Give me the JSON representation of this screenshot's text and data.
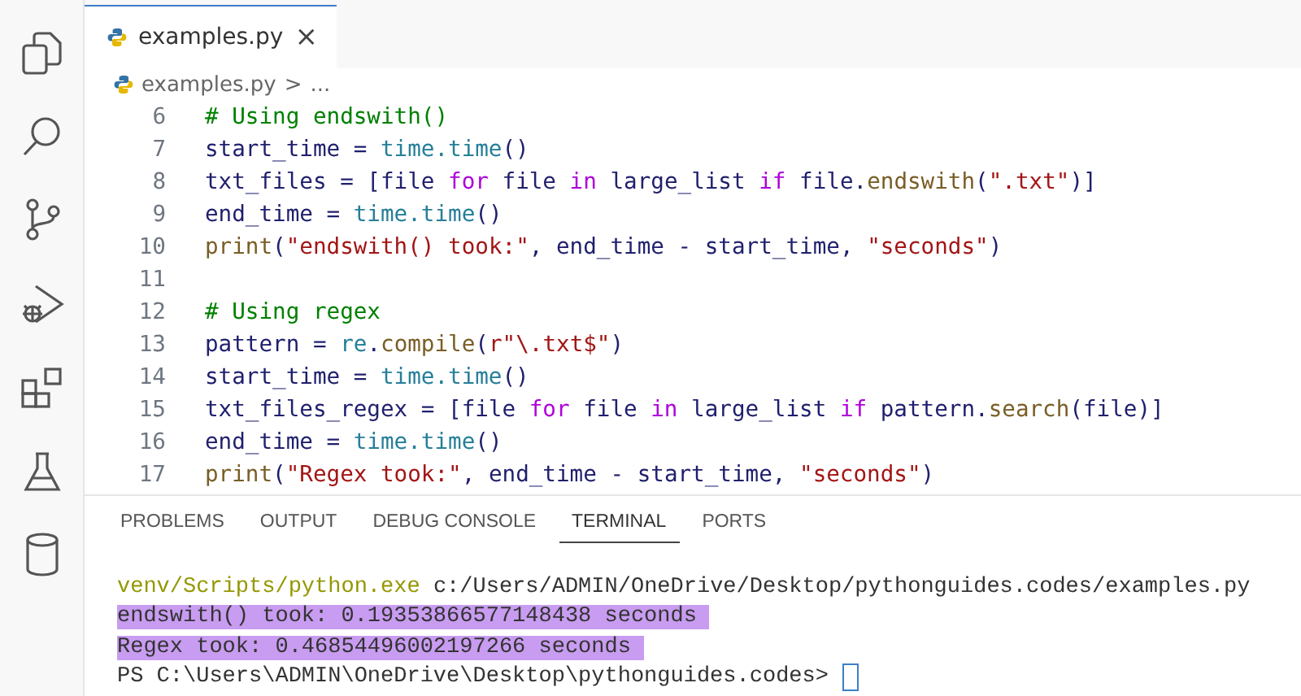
{
  "editor_tab": {
    "label": "examples.py",
    "close": "×",
    "selected": true
  },
  "breadcrumb": {
    "file": "examples.py",
    "separator": ">",
    "rest": "..."
  },
  "code_lines": [
    {
      "number": "6",
      "tokens": [
        {
          "kind": "comment",
          "text": "# Using endswith()"
        }
      ]
    },
    {
      "number": "7",
      "tokens": [
        {
          "kind": "plain",
          "text": "start_time = "
        },
        {
          "kind": "module",
          "text": "time.time"
        },
        {
          "kind": "plain",
          "text": "()"
        }
      ]
    },
    {
      "number": "8",
      "tokens": [
        {
          "kind": "plain",
          "text": "txt_files = [file "
        },
        {
          "kind": "keyword",
          "text": "for"
        },
        {
          "kind": "plain",
          "text": " file "
        },
        {
          "kind": "keyword",
          "text": "in"
        },
        {
          "kind": "plain",
          "text": " large_list "
        },
        {
          "kind": "keyword",
          "text": "if"
        },
        {
          "kind": "plain",
          "text": " file."
        },
        {
          "kind": "function",
          "text": "endswith"
        },
        {
          "kind": "plain",
          "text": "("
        },
        {
          "kind": "string",
          "text": "\".txt\""
        },
        {
          "kind": "plain",
          "text": ")]"
        }
      ]
    },
    {
      "number": "9",
      "tokens": [
        {
          "kind": "plain",
          "text": "end_time = "
        },
        {
          "kind": "module",
          "text": "time.time"
        },
        {
          "kind": "plain",
          "text": "()"
        }
      ]
    },
    {
      "number": "10",
      "tokens": [
        {
          "kind": "function",
          "text": "print"
        },
        {
          "kind": "plain",
          "text": "("
        },
        {
          "kind": "string",
          "text": "\"endswith() took:\""
        },
        {
          "kind": "plain",
          "text": ", end_time - start_time, "
        },
        {
          "kind": "string",
          "text": "\"seconds\""
        },
        {
          "kind": "plain",
          "text": ")"
        }
      ]
    },
    {
      "number": "11"
    },
    {
      "number": "12",
      "tokens": [
        {
          "kind": "comment",
          "text": "# Using regex"
        }
      ]
    },
    {
      "number": "13",
      "tokens": [
        {
          "kind": "plain",
          "text": "pattern = "
        },
        {
          "kind": "module",
          "text": "re"
        },
        {
          "kind": "plain",
          "text": "."
        },
        {
          "kind": "function",
          "text": "compile"
        },
        {
          "kind": "plain",
          "text": "("
        },
        {
          "kind": "string",
          "text": "r\"\\.txt$\""
        },
        {
          "kind": "plain",
          "text": ")"
        }
      ]
    },
    {
      "number": "14",
      "tokens": [
        {
          "kind": "plain",
          "text": "start_time = "
        },
        {
          "kind": "module",
          "text": "time.time"
        },
        {
          "kind": "plain",
          "text": "()"
        }
      ]
    },
    {
      "number": "15",
      "tokens": [
        {
          "kind": "plain",
          "text": "txt_files_regex = [file "
        },
        {
          "kind": "keyword",
          "text": "for"
        },
        {
          "kind": "plain",
          "text": " file "
        },
        {
          "kind": "keyword",
          "text": "in"
        },
        {
          "kind": "plain",
          "text": " large_list "
        },
        {
          "kind": "keyword",
          "text": "if"
        },
        {
          "kind": "plain",
          "text": " pattern."
        },
        {
          "kind": "function",
          "text": "search"
        },
        {
          "kind": "plain",
          "text": "(file)]"
        }
      ]
    },
    {
      "number": "16",
      "tokens": [
        {
          "kind": "plain",
          "text": "end_time = "
        },
        {
          "kind": "module",
          "text": "time.time"
        },
        {
          "kind": "plain",
          "text": "()"
        }
      ]
    },
    {
      "number": "17",
      "tokens": [
        {
          "kind": "function",
          "text": "print"
        },
        {
          "kind": "plain",
          "text": "("
        },
        {
          "kind": "string",
          "text": "\"Regex took:\""
        },
        {
          "kind": "plain",
          "text": ", end_time - start_time, "
        },
        {
          "kind": "string",
          "text": "\"seconds\""
        },
        {
          "kind": "plain",
          "text": ")"
        }
      ]
    }
  ],
  "panel_tabs": [
    {
      "label": "PROBLEMS",
      "selected": false
    },
    {
      "label": "OUTPUT",
      "selected": false
    },
    {
      "label": "DEBUG CONSOLE",
      "selected": false
    },
    {
      "label": "TERMINAL",
      "selected": true
    },
    {
      "label": "PORTS",
      "selected": false
    }
  ],
  "terminal_lines": [
    {
      "highlighted": false,
      "cursor": false,
      "segments": [
        {
          "kind": "command",
          "text": "venv/Scripts/python.exe"
        },
        {
          "kind": "plain",
          "text": " c:/Users/ADMIN/OneDrive/Desktop/pythonguides.codes/examples.py"
        }
      ]
    },
    {
      "highlighted": true,
      "cursor": false,
      "segments": [
        {
          "kind": "plain",
          "text": "endswith() took: 0.19353866577148438 seconds"
        }
      ]
    },
    {
      "highlighted": true,
      "cursor": false,
      "segments": [
        {
          "kind": "plain",
          "text": "Regex took: 0.46854496002197266 seconds"
        }
      ]
    },
    {
      "highlighted": false,
      "cursor": true,
      "segments": [
        {
          "kind": "plain",
          "text": "PS C:\\Users\\ADMIN\\OneDrive\\Desktop\\pythonguides.codes> "
        }
      ]
    }
  ]
}
